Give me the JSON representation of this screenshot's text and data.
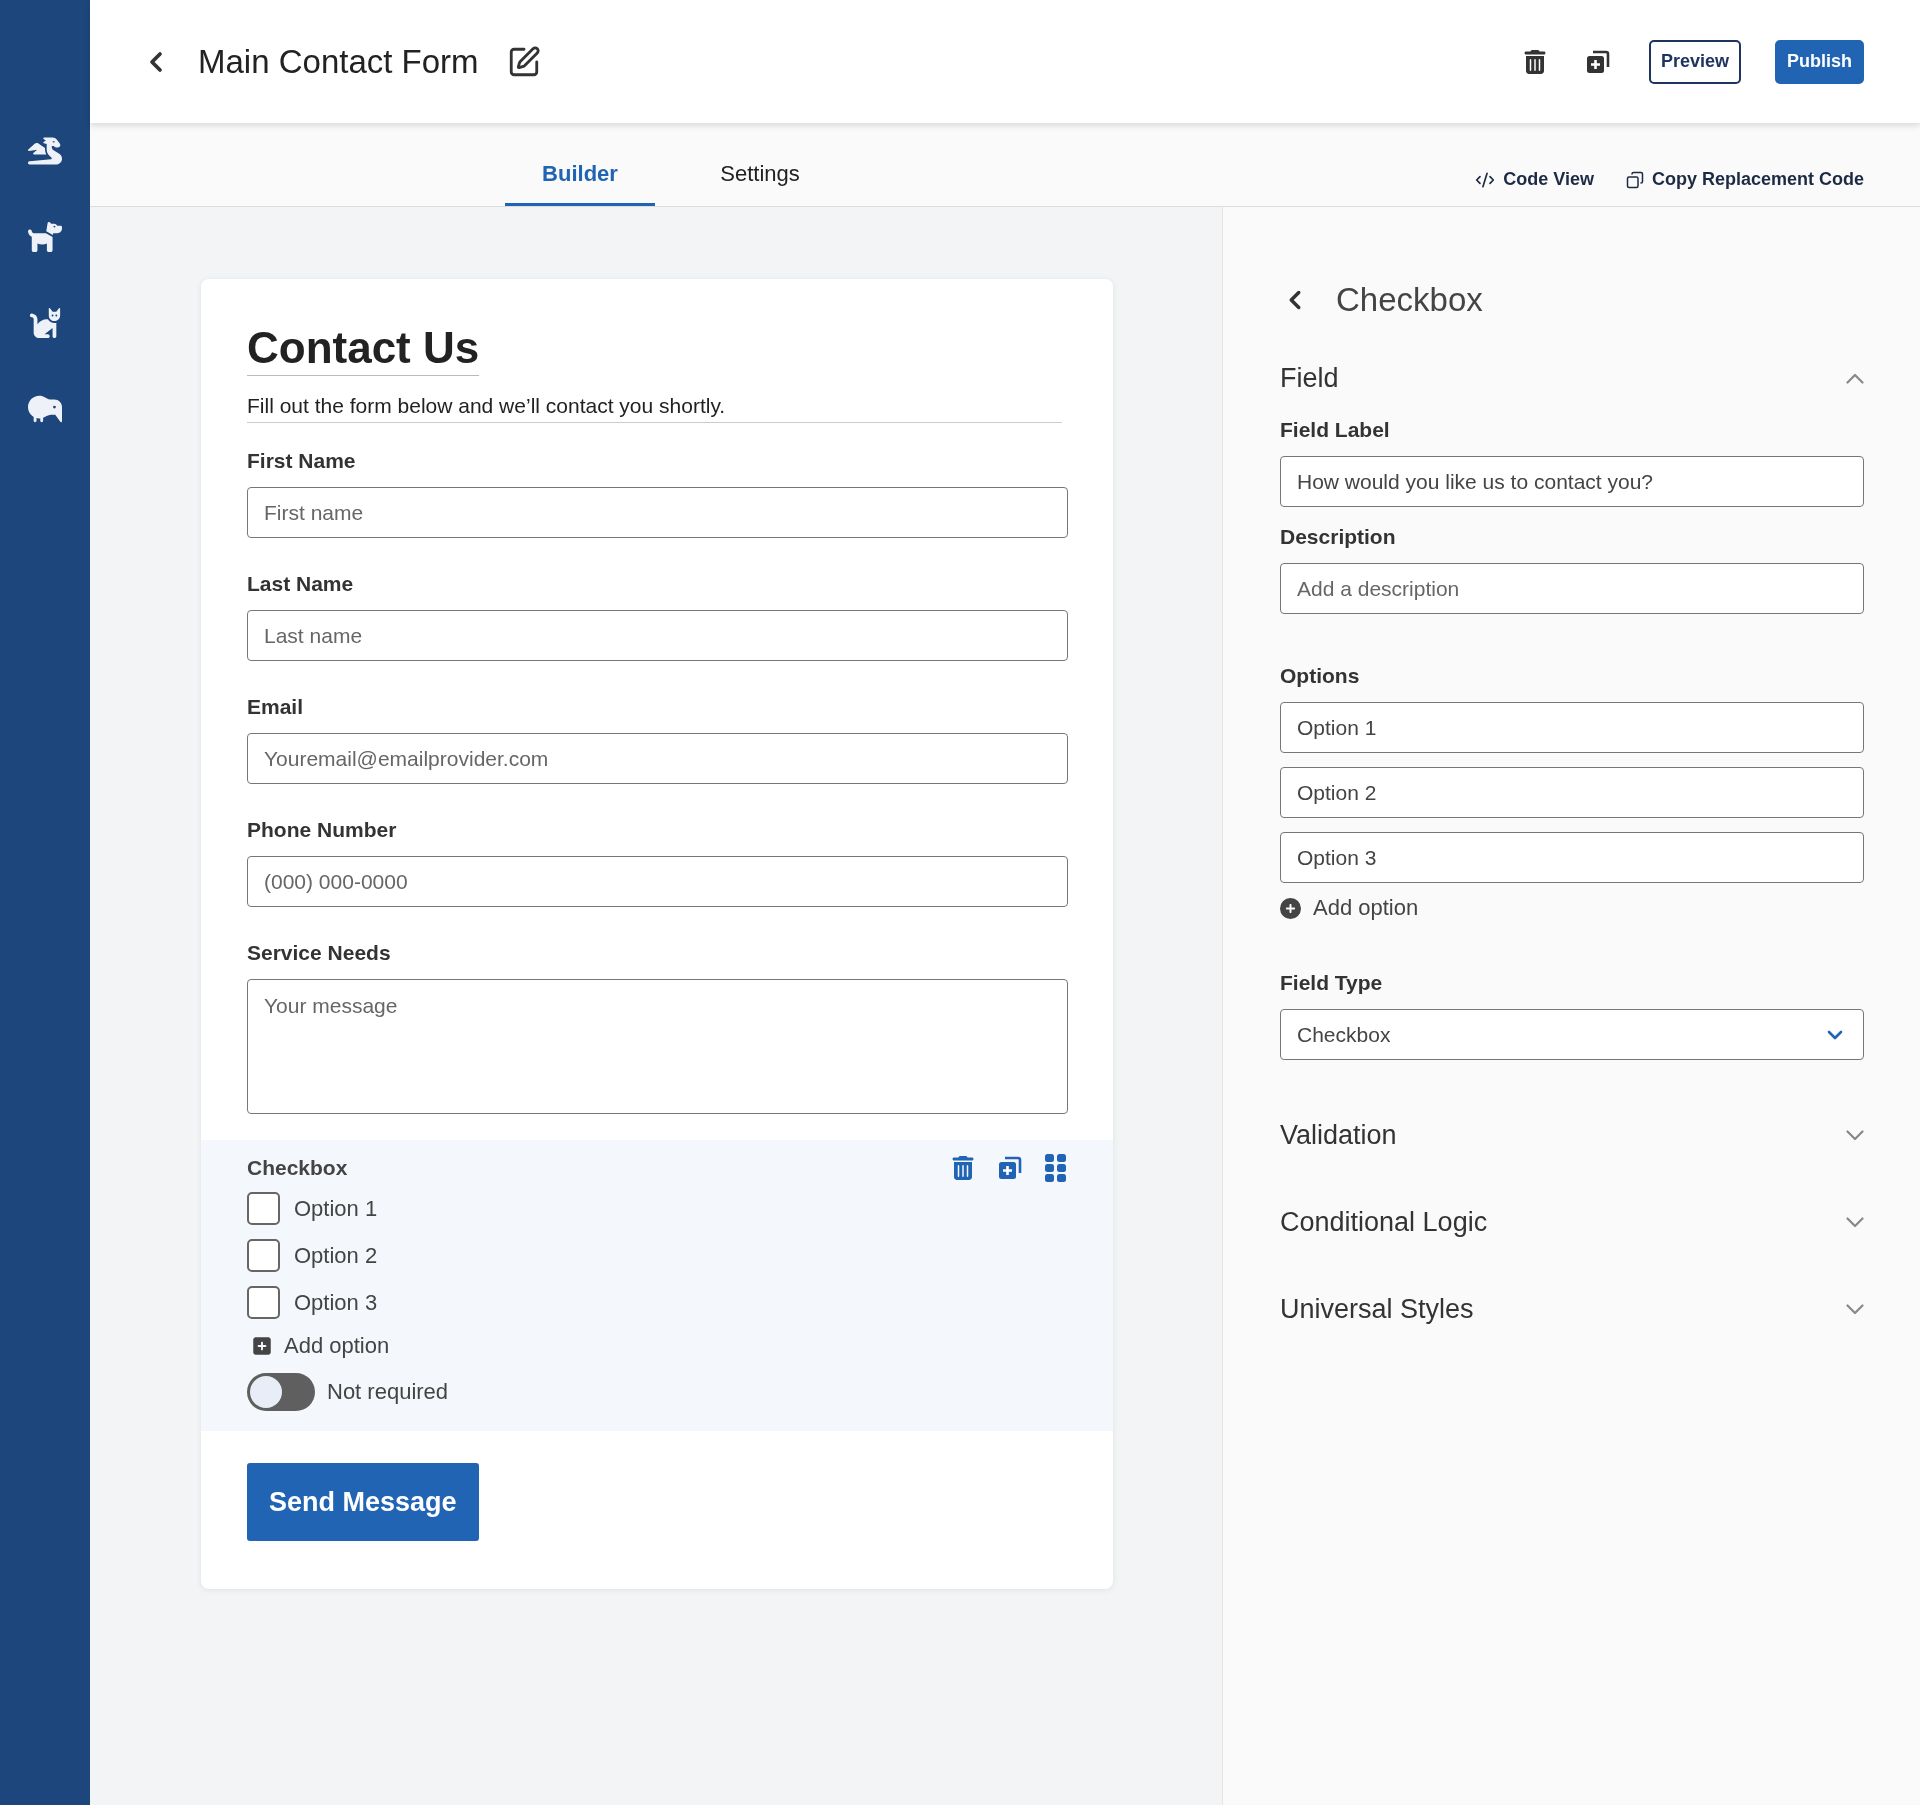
{
  "header": {
    "title": "Main Contact Form",
    "buttons": [
      {
        "label": "Preview",
        "kind": "outline"
      },
      {
        "label": "Publish",
        "kind": "primary"
      }
    ]
  },
  "tabs": [
    {
      "label": "Builder",
      "selected": true
    },
    {
      "label": "Settings",
      "selected": false
    }
  ],
  "tab_actions": [
    {
      "label": "Code View",
      "kind": "code"
    },
    {
      "label": "Copy Replacement Code",
      "kind": "copy"
    }
  ],
  "form": {
    "title": "Contact Us",
    "description": "Fill out the form below and we’ll contact you shortly.",
    "fields": [
      {
        "kind": "input",
        "label": "First Name",
        "placeholder": "First name"
      },
      {
        "kind": "input",
        "label": "Last Name",
        "placeholder": "Last name"
      },
      {
        "kind": "input",
        "label": "Email",
        "placeholder": "Youremail@emailprovider.com"
      },
      {
        "kind": "input",
        "label": "Phone Number",
        "placeholder": "(000) 000-0000"
      },
      {
        "kind": "textarea",
        "label": "Service Needs",
        "placeholder": "Your message"
      },
      {
        "kind": "checkbox",
        "label": "Checkbox",
        "selected": true,
        "options": [
          {
            "label": "Option 1",
            "checked": false
          },
          {
            "label": "Option 2",
            "checked": false
          },
          {
            "label": "Option 3",
            "checked": false
          }
        ],
        "add_option": "Add option",
        "required": {
          "label": "Not required",
          "on": false
        }
      }
    ],
    "submit": "Send Message"
  },
  "panel": {
    "title": "Checkbox",
    "sections": [
      {
        "title": "Field",
        "expanded": true,
        "field_label": {
          "label": "Field Label",
          "value": "How would you like us to contact you?"
        },
        "description": {
          "label": "Description",
          "placeholder": "Add a description"
        },
        "options": {
          "label": "Options",
          "values": [
            "Option 1",
            "Option 2",
            "Option 3"
          ],
          "add": "Add option"
        },
        "field_type": {
          "label": "Field Type",
          "value": "Checkbox"
        }
      },
      {
        "title": "Validation",
        "expanded": false
      },
      {
        "title": "Conditional Logic",
        "expanded": false
      },
      {
        "title": "Universal Styles",
        "expanded": false
      }
    ]
  }
}
